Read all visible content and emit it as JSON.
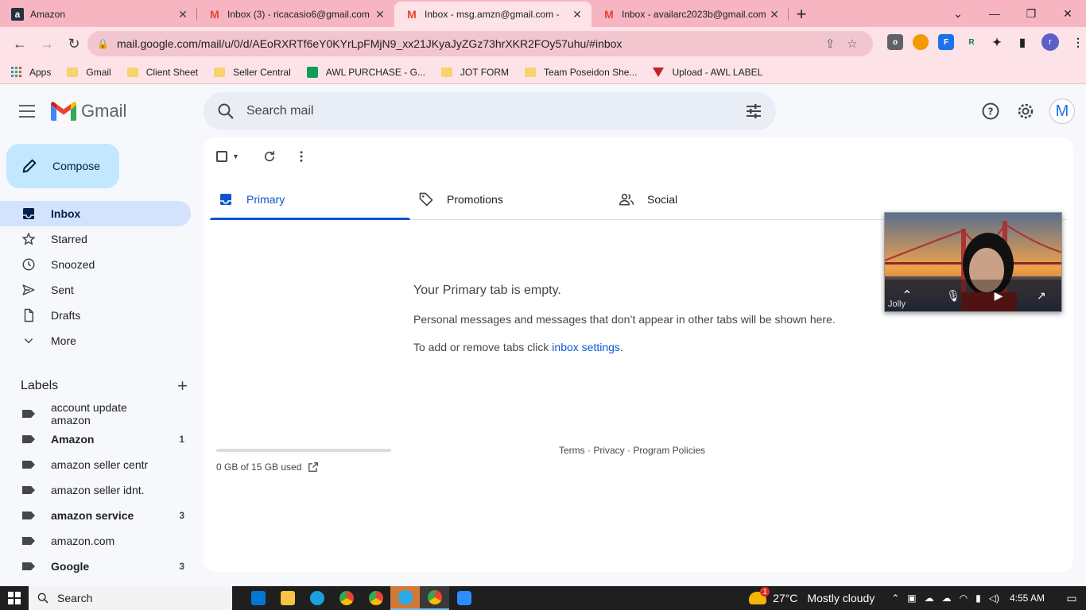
{
  "browser": {
    "tabs": [
      {
        "title": "Amazon",
        "icon": "amazon-icon",
        "active": false
      },
      {
        "title": "Inbox (3) - ricacasio6@gmail.com",
        "icon": "gmail-icon",
        "active": false
      },
      {
        "title": "Inbox - msg.amzn@gmail.com -",
        "icon": "gmail-icon",
        "active": true
      },
      {
        "title": "Inbox - availarc2023b@gmail.com",
        "icon": "gmail-icon",
        "active": false
      }
    ],
    "url": "mail.google.com/mail/u/0/d/AEoRXRTf6eY0KYrLpFMjN9_xx21JKyaJyZGz73hrXKR2FOy57uhu/#inbox",
    "profile_initial": "r",
    "bookmarks": [
      {
        "label": "Apps",
        "type": "apps"
      },
      {
        "label": "Gmail",
        "type": "folder"
      },
      {
        "label": "Client Sheet",
        "type": "folder"
      },
      {
        "label": "Seller Central",
        "type": "folder"
      },
      {
        "label": "AWL PURCHASE - G...",
        "type": "sheet"
      },
      {
        "label": "JOT FORM",
        "type": "folder"
      },
      {
        "label": "Team Poseidon She...",
        "type": "folder"
      },
      {
        "label": "Upload - AWL LABEL",
        "type": "awl"
      }
    ]
  },
  "gmail": {
    "logo_text": "Gmail",
    "search_placeholder": "Search mail",
    "avatar_initial": "M",
    "compose_label": "Compose",
    "nav": [
      {
        "label": "Inbox",
        "icon": "inbox-icon",
        "active": true
      },
      {
        "label": "Starred",
        "icon": "star-icon",
        "active": false
      },
      {
        "label": "Snoozed",
        "icon": "clock-icon",
        "active": false
      },
      {
        "label": "Sent",
        "icon": "send-icon",
        "active": false
      },
      {
        "label": "Drafts",
        "icon": "draft-icon",
        "active": false
      },
      {
        "label": "More",
        "icon": "chevron-down-icon",
        "active": false
      }
    ],
    "labels_heading": "Labels",
    "labels": [
      {
        "name": "account update amazon",
        "count": "",
        "bold": false
      },
      {
        "name": "Amazon",
        "count": "1",
        "bold": true
      },
      {
        "name": "amazon seller centr",
        "count": "",
        "bold": false
      },
      {
        "name": "amazon seller idnt.",
        "count": "",
        "bold": false
      },
      {
        "name": "amazon service",
        "count": "3",
        "bold": true
      },
      {
        "name": "amazon.com",
        "count": "",
        "bold": false
      },
      {
        "name": "Google",
        "count": "3",
        "bold": true
      }
    ],
    "tabs": [
      {
        "label": "Primary",
        "icon": "inbox-tab-icon",
        "active": true
      },
      {
        "label": "Promotions",
        "icon": "tag-icon",
        "active": false
      },
      {
        "label": "Social",
        "icon": "people-icon",
        "active": false
      }
    ],
    "empty": {
      "title": "Your Primary tab is empty.",
      "description": "Personal messages and messages that don’t appear in other tabs will be shown here.",
      "settings_prefix": "To add or remove tabs click ",
      "settings_link": "inbox settings",
      "settings_suffix": "."
    },
    "storage_text": "0 GB of 15 GB used",
    "footer": "Terms · Privacy · Program Policies"
  },
  "video_overlay": {
    "name": "Jolly"
  },
  "taskbar": {
    "search_label": "Search",
    "weather_badge": "1",
    "temperature": "27°C",
    "weather": "Mostly cloudy",
    "time": "4:55 AM"
  },
  "colors": {
    "tab_strip": "#f7b5c2",
    "toolbar": "#fde3e8",
    "compose": "#c2e7ff",
    "active_nav": "#d3e3fd",
    "accent": "#0b57d0"
  }
}
